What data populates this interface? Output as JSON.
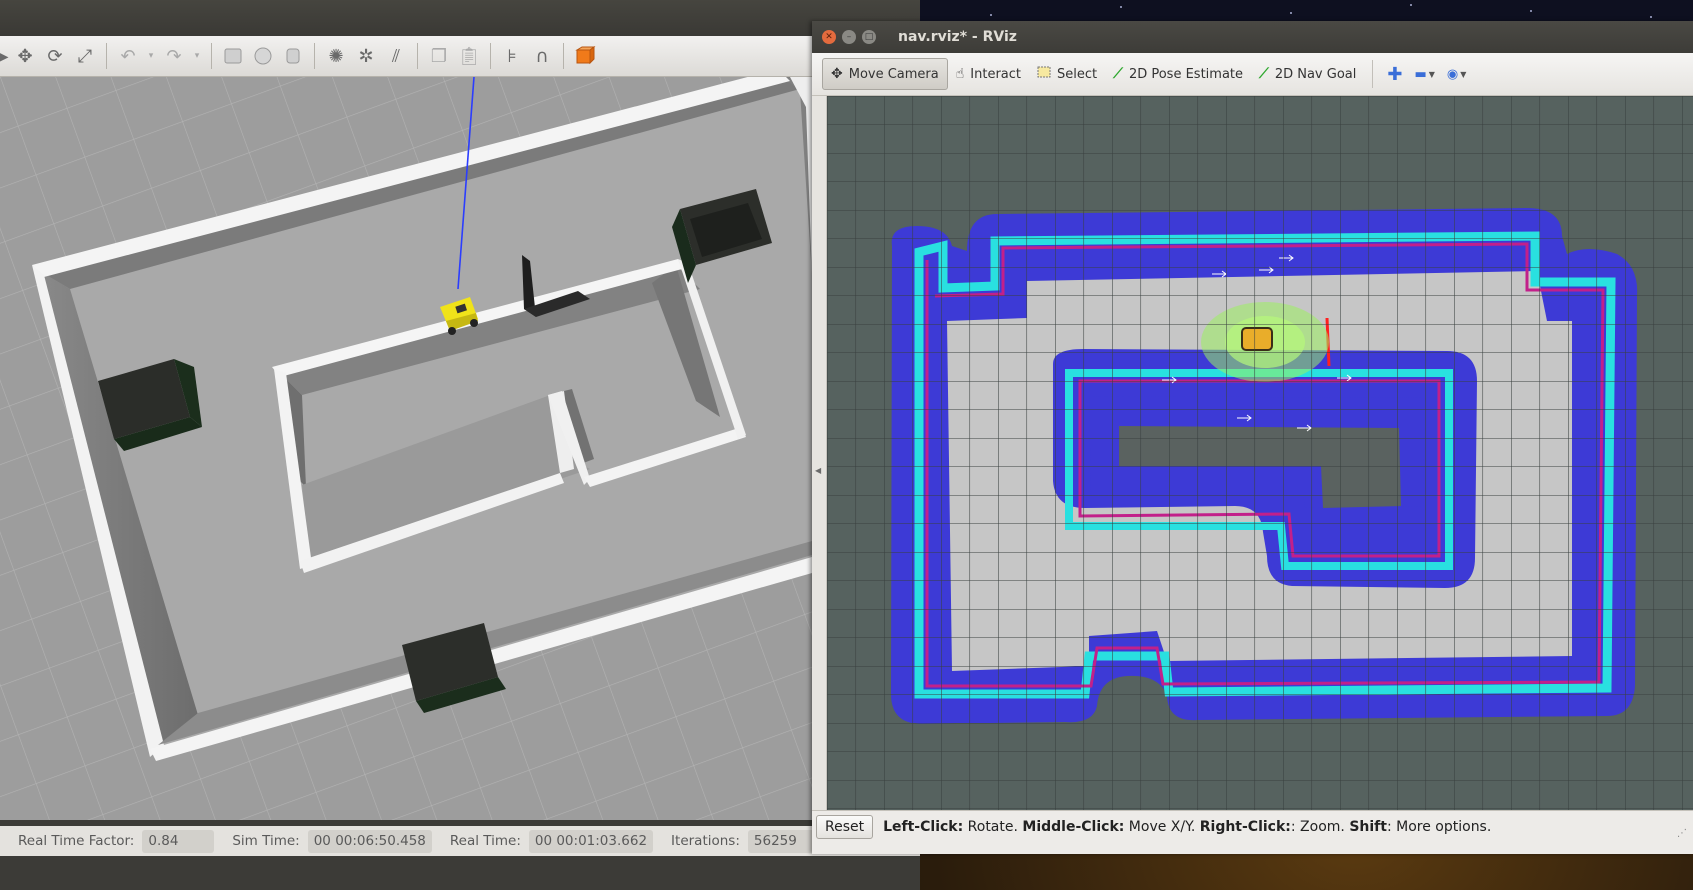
{
  "gazebo": {
    "status": {
      "rtf_label": "Real Time Factor:",
      "rtf_value": "0.84",
      "sim_label": "Sim Time:",
      "sim_value": "00 00:06:50.458",
      "real_label": "Real Time:",
      "real_value": "00 00:01:03.662",
      "iter_label": "Iterations:",
      "iter_value": "56259"
    },
    "toolbar_icons": [
      "select-icon",
      "translate-icon",
      "rotate-icon",
      "scale-icon",
      "undo-icon",
      "undo-dropdown-icon",
      "redo-icon",
      "redo-dropdown-icon",
      "box-shape-icon",
      "sphere-shape-icon",
      "cylinder-shape-icon",
      "point-light-icon",
      "spot-light-icon",
      "directional-light-icon",
      "copy-icon",
      "paste-icon",
      "align-icon",
      "snap-icon",
      "view-angle-icon"
    ]
  },
  "rviz": {
    "title": "nav.rviz* - RViz",
    "tools": {
      "move_camera": "Move Camera",
      "interact": "Interact",
      "select": "Select",
      "pose_estimate": "2D Pose Estimate",
      "nav_goal": "2D Nav Goal"
    },
    "status": {
      "reset": "Reset",
      "left_click": "Left-Click:",
      "left_action": " Rotate. ",
      "middle_click": "Middle-Click:",
      "middle_action": " Move X/Y. ",
      "right_click": "Right-Click:",
      "right_action": ": Zoom. ",
      "shift": "Shift",
      "shift_action": ": More options."
    }
  },
  "colors": {
    "costmap_outer": "#3d3ad6",
    "costmap_cyan": "#29e0e0",
    "costmap_magenta": "#c2208a",
    "free_space": "#c6c6c6",
    "unknown": "#56625f",
    "particles": "#9cf060",
    "robot": "#e9ad2a"
  }
}
